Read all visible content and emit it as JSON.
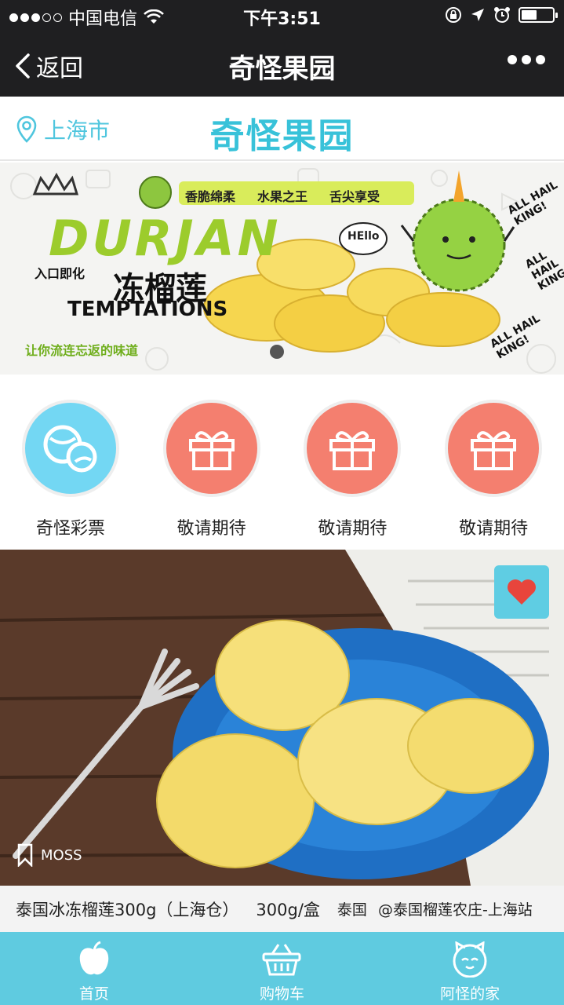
{
  "status_bar": {
    "carrier": "中国电信",
    "time": "下午3:51",
    "signal_strength": 3,
    "battery_level": 0.45,
    "icons": [
      "wifi-icon",
      "rotation-lock-icon",
      "location-arrow-icon",
      "alarm-icon",
      "battery-icon"
    ]
  },
  "nav": {
    "back_label": "返回",
    "title": "奇怪果园"
  },
  "header": {
    "location": "上海市",
    "brand": "奇怪果园"
  },
  "banner": {
    "slogans": [
      "香脆绵柔",
      "水果之王",
      "舌尖享受"
    ],
    "word": "DURJAN",
    "cn_title": "冻榴莲",
    "melt_text": "入口即化",
    "temptations": "TEMPTATIONS",
    "subtitle": "让你流连忘返的味道",
    "hello": "HEllo",
    "king_text": "ALL HAIL KING!",
    "slide_count": 1,
    "active_slide": 1
  },
  "entries": [
    {
      "label": "奇怪彩票",
      "icon": "lottery-ball-icon",
      "color": "#73d7f3"
    },
    {
      "label": "敬请期待",
      "icon": "gift-icon",
      "color": "#f47f6f"
    },
    {
      "label": "敬请期待",
      "icon": "gift-icon",
      "color": "#f47f6f"
    },
    {
      "label": "敬请期待",
      "icon": "gift-icon",
      "color": "#f47f6f"
    }
  ],
  "product": {
    "tag": "MOSS",
    "name": "泰国冰冻榴莲300g（上海仓）",
    "spec": "300g/盒",
    "origin": "泰国",
    "store": "@泰国榴莲农庄-上海站",
    "favorite_icon": "heart-icon"
  },
  "tabs": [
    {
      "label": "首页",
      "icon": "apple-icon",
      "active": true
    },
    {
      "label": "购物车",
      "icon": "basket-icon",
      "active": false
    },
    {
      "label": "阿怪的家",
      "icon": "cat-face-icon",
      "active": false
    }
  ],
  "colors": {
    "accent": "#38c2d9",
    "tab_bar": "#5fcbe0",
    "entry_blue": "#73d7f3",
    "entry_coral": "#f47f6f",
    "dark_bar": "#1f1f21"
  }
}
